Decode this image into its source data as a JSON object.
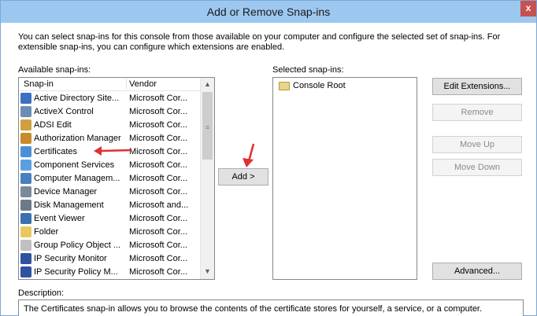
{
  "window": {
    "title": "Add or Remove Snap-ins",
    "close_label": "x"
  },
  "intro_text": "You can select snap-ins for this console from those available on your computer and configure the selected set of snap-ins. For extensible snap-ins, you can configure which extensions are enabled.",
  "available": {
    "label": "Available snap-ins:",
    "col_snapin": "Snap-in",
    "col_vendor": "Vendor",
    "items": [
      {
        "name": "Active Directory Site...",
        "vendor": "Microsoft Cor...",
        "icon": "active-directory-icon",
        "color": "#3a6fc4"
      },
      {
        "name": "ActiveX Control",
        "vendor": "Microsoft Cor...",
        "icon": "activex-icon",
        "color": "#6a8db8"
      },
      {
        "name": "ADSI Edit",
        "vendor": "Microsoft Cor...",
        "icon": "adsi-edit-icon",
        "color": "#d0a040"
      },
      {
        "name": "Authorization Manager",
        "vendor": "Microsoft Cor...",
        "icon": "authorization-icon",
        "color": "#c98a2a"
      },
      {
        "name": "Certificates",
        "vendor": "Microsoft Cor...",
        "icon": "certificates-icon",
        "color": "#4a90d9"
      },
      {
        "name": "Component Services",
        "vendor": "Microsoft Cor...",
        "icon": "component-services-icon",
        "color": "#5aa0e0"
      },
      {
        "name": "Computer Managem...",
        "vendor": "Microsoft Cor...",
        "icon": "computer-management-icon",
        "color": "#4a7fc0"
      },
      {
        "name": "Device Manager",
        "vendor": "Microsoft Cor...",
        "icon": "device-manager-icon",
        "color": "#7a8a9a"
      },
      {
        "name": "Disk Management",
        "vendor": "Microsoft and...",
        "icon": "disk-management-icon",
        "color": "#6a7a8a"
      },
      {
        "name": "Event Viewer",
        "vendor": "Microsoft Cor...",
        "icon": "event-viewer-icon",
        "color": "#3a70b0"
      },
      {
        "name": "Folder",
        "vendor": "Microsoft Cor...",
        "icon": "folder-icon",
        "color": "#e8c860"
      },
      {
        "name": "Group Policy Object ...",
        "vendor": "Microsoft Cor...",
        "icon": "group-policy-icon",
        "color": "#c0c0c0"
      },
      {
        "name": "IP Security Monitor",
        "vendor": "Microsoft Cor...",
        "icon": "ip-security-monitor-icon",
        "color": "#3050a0"
      },
      {
        "name": "IP Security Policy M...",
        "vendor": "Microsoft Cor...",
        "icon": "ip-security-policy-icon",
        "color": "#3050a0"
      }
    ]
  },
  "add_button": "Add >",
  "selected": {
    "label": "Selected snap-ins:",
    "root": "Console Root"
  },
  "buttons": {
    "edit_extensions": "Edit Extensions...",
    "remove": "Remove",
    "move_up": "Move Up",
    "move_down": "Move Down",
    "advanced": "Advanced..."
  },
  "description": {
    "label": "Description:",
    "text": "The Certificates snap-in allows you to browse the contents of the certificate stores for yourself, a service, or a computer."
  },
  "annotation_color": "#e03030"
}
